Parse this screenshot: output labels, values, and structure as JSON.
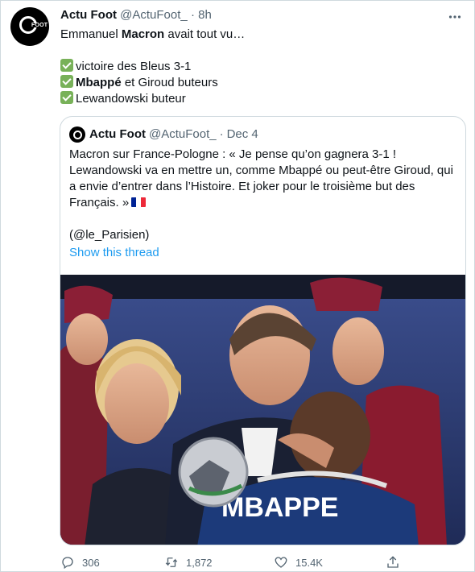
{
  "tweet": {
    "author_name": "Actu Foot",
    "author_handle": "@ActuFoot_",
    "separator": "·",
    "time": "8h",
    "avatar_text": "FOOT",
    "text_lead": "Emmanuel ",
    "text_bold": "Macron",
    "text_tail": " avait tout vu…",
    "lines": [
      {
        "bold": "",
        "text": "victoire des Bleus 3-1"
      },
      {
        "bold": "Mbappé",
        "text": " et Giroud buteurs"
      },
      {
        "bold": "",
        "text": "Lewandowski buteur"
      }
    ]
  },
  "quoted": {
    "author_name": "Actu Foot",
    "author_handle": "@ActuFoot_",
    "separator": "·",
    "date": "Dec 4",
    "text": "Macron sur France-Pologne : « Je pense qu’on gagnera 3-1 ! Lewandowski va en mettre un, comme Mbappé ou peut-être Giroud, qui a envie d’entrer dans l’Histoire. Et joker pour le troisième but des Français. »",
    "source": "(@le_Parisien)",
    "show_thread": "Show this thread",
    "photo_text": "MBAPPE"
  },
  "actions": {
    "replies": "306",
    "retweets": "1,872",
    "likes": "15.4K"
  },
  "colors": {
    "accent": "#1d9bf0",
    "muted": "#536471",
    "border": "#cfd9de",
    "check": "#78b159"
  }
}
